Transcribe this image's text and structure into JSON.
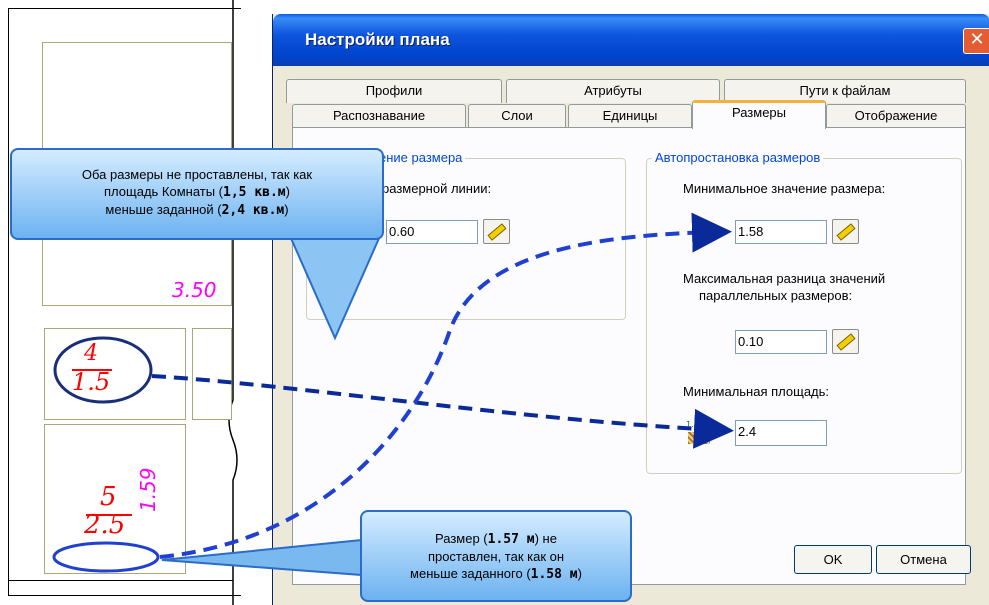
{
  "window": {
    "title": "Настройки плана",
    "close_glyph": "✕"
  },
  "tabs": {
    "row1": [
      "Профили",
      "Атрибуты",
      "Пути к файлам"
    ],
    "row2": [
      "Распознавание",
      "Слои",
      "Единицы",
      "Размеры",
      "Отображение"
    ],
    "active": "Размеры"
  },
  "left_group": {
    "title": "ение размера",
    "label": "размерной линии:",
    "value": "0.60"
  },
  "auto_group": {
    "title": "Автопростановка размеров",
    "min_value_label": "Минимальное значение размера:",
    "min_value": "1.58",
    "max_diff_label_1": "Максимальная разница значений",
    "max_diff_label_2": "параллельных размеров:",
    "max_diff": "0.10",
    "min_area_label": "Минимальная площадь:",
    "min_area": "2.4",
    "area_icon_text": "1.m2"
  },
  "buttons": {
    "ok": "OK",
    "cancel": "Отмена",
    "small": "?"
  },
  "plan": {
    "dim_350": "3.50",
    "room1_num": "4",
    "room1_area": "1.5",
    "room2_num": "5",
    "room2_area": "2.5",
    "vertical_dim": "1.59"
  },
  "callout_top": {
    "line1": "Оба размеры не проставлены, так как",
    "line2a": "площадь Комнаты (",
    "line2b": "1,5 кв.м",
    "line2c": ")",
    "line3a": "меньше заданной (",
    "line3b": "2,4 кв.м",
    "line3c": ")"
  },
  "callout_bottom": {
    "line1a": "Размер (",
    "line1b": "1.57 м",
    "line1c": ") не",
    "line2": "проставлен, так как он",
    "line3a": "меньше заданного (",
    "line3b": "1.58 м",
    "line3c": ")"
  },
  "colors": {
    "title_blue": "#0054e3",
    "active_tab": "#f8b03c",
    "group_title": "#0046d5",
    "arrow": "#0a2a9a",
    "cad_red": "#ff0000",
    "cad_magenta": "#ff00ff"
  }
}
